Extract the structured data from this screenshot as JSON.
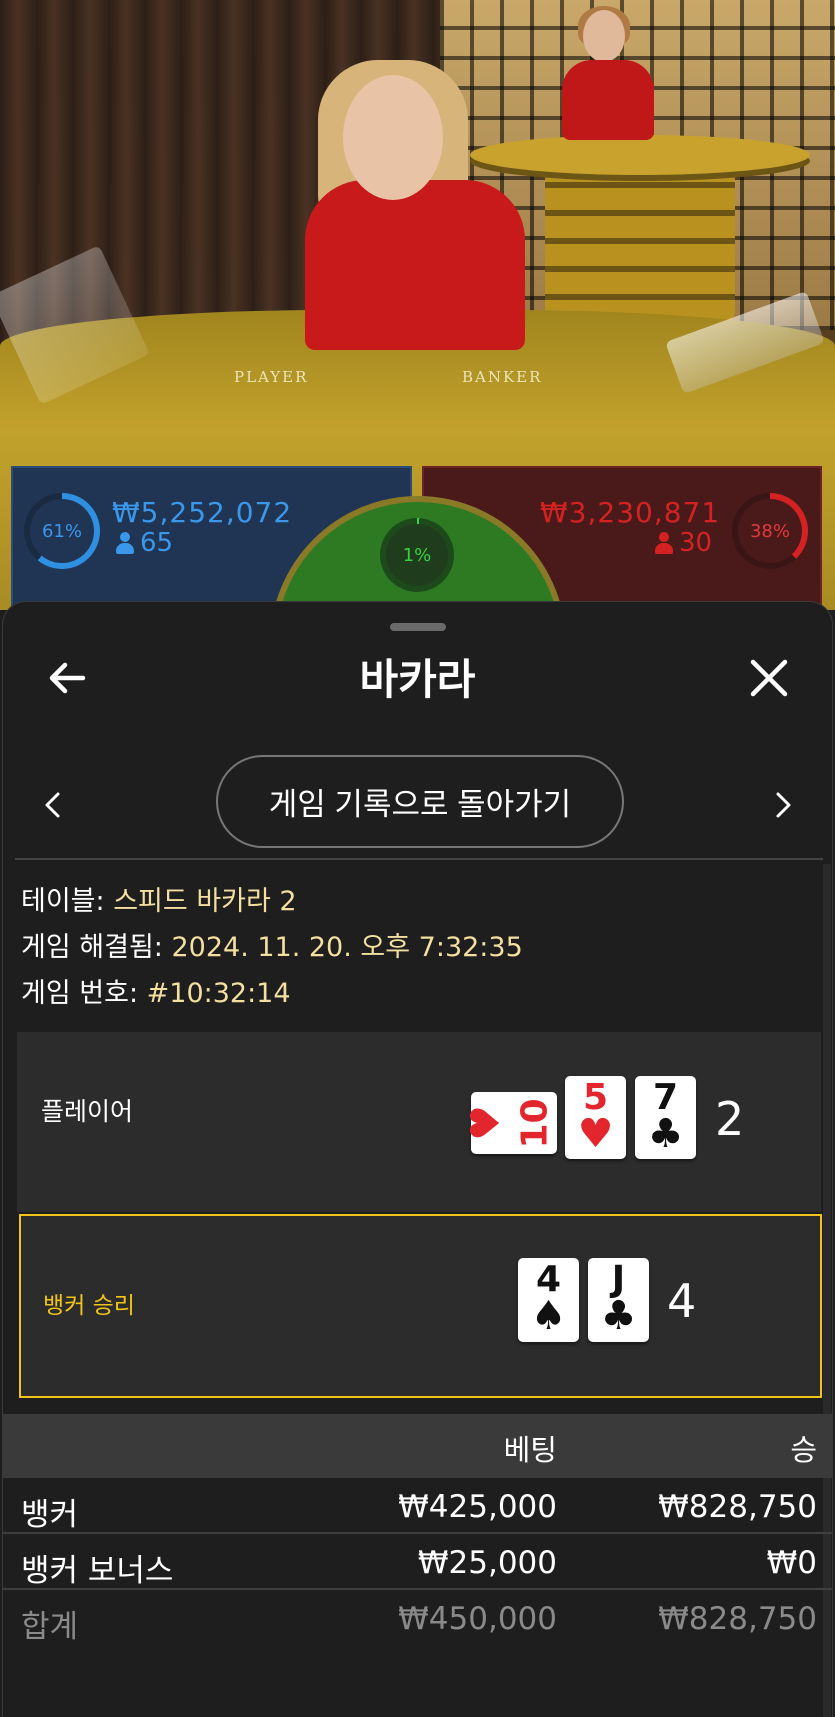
{
  "scene": {
    "felt_player_label": "PLAYER",
    "felt_banker_label": "BANKER"
  },
  "stats": {
    "player": {
      "percent": "61%",
      "percent_value": 61,
      "amount": "₩5,252,072",
      "count": "65",
      "color": "#2f8fe0"
    },
    "tie": {
      "percent": "1%",
      "percent_value": 1,
      "color": "#42d04a"
    },
    "banker": {
      "percent": "38%",
      "percent_value": 38,
      "amount": "₩3,230,871",
      "count": "30",
      "color": "#d42222"
    }
  },
  "sheet": {
    "title": "바카라",
    "back_icon": "arrow-left-icon",
    "close_icon": "close-icon",
    "history_button": "게임 기록으로 돌아가기"
  },
  "info": {
    "table_label": "테이블:",
    "table_value": "스피드 바카라 2",
    "resolved_label": "게임 해결됨:",
    "resolved_value": "2024. 11. 20. 오후 7:32:35",
    "number_label": "게임 번호:",
    "number_value": "#10:32:14"
  },
  "hands": {
    "player": {
      "label": "플레이어",
      "score": "2",
      "cards": [
        {
          "rank": "10",
          "suit": "♥",
          "color": "red",
          "sideways": true
        },
        {
          "rank": "5",
          "suit": "♥",
          "color": "red"
        },
        {
          "rank": "7",
          "suit": "♣",
          "color": "black"
        }
      ]
    },
    "banker": {
      "label": "뱅커 승리",
      "score": "4",
      "highlight_color": "#f0c419",
      "cards": [
        {
          "rank": "4",
          "suit": "♠",
          "color": "black"
        },
        {
          "rank": "J",
          "suit": "♣",
          "color": "black"
        }
      ]
    }
  },
  "bets": {
    "headers": {
      "bet": "베팅",
      "win": "승"
    },
    "rows": [
      {
        "name": "뱅커",
        "bet": "₩425,000",
        "win": "₩828,750"
      },
      {
        "name": "뱅커 보너스",
        "bet": "₩25,000",
        "win": "₩0"
      }
    ],
    "total": {
      "name": "합계",
      "bet": "₩450,000",
      "win": "₩828,750"
    }
  }
}
